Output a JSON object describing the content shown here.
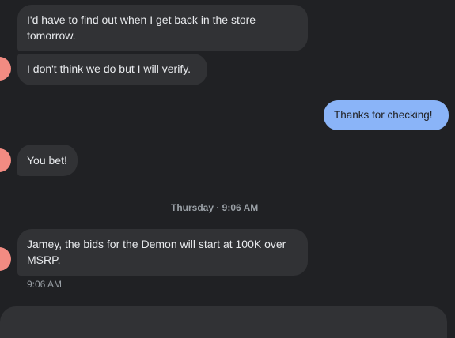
{
  "messages": {
    "m1": "I'd have to find out when I get back in the store tomorrow.",
    "m2": "I don't think we do but I will verify.",
    "m3": "Thanks for checking!",
    "m4": "You bet!",
    "m5": "Jamey, the bids for the Demon will start at 100K over MSRP."
  },
  "timestamps": {
    "day_divider": "Thursday · 9:06 AM",
    "last_sent": "9:06 AM"
  },
  "colors": {
    "incoming_bubble": "#313235",
    "outgoing_bubble": "#8ab4f8",
    "avatar": "#f28b82"
  }
}
